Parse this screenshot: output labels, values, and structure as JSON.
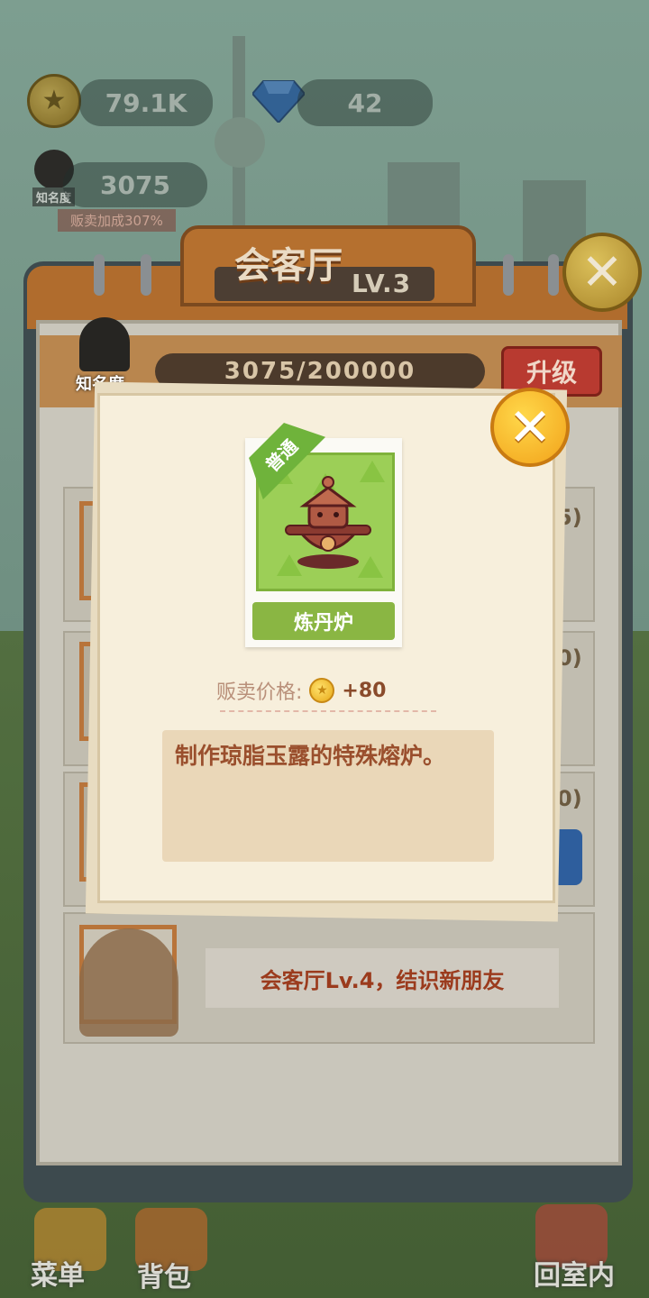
{
  "hud": {
    "coins": "79.1K",
    "gems": "42",
    "fame_value": "3075",
    "fame_label": "知名度",
    "sell_bonus": "贩卖加成307%"
  },
  "hall": {
    "title": "会客厅",
    "level": "LV.3",
    "fame_label": "知名度",
    "fame_progress": "3075/200000",
    "upgrade_label": "升级",
    "side_values": [
      "5)",
      "0)",
      "0)"
    ],
    "locked_text": "会客厅Lv.4，结识新朋友"
  },
  "popup": {
    "rarity": "普通",
    "item_name": "炼丹炉",
    "price_label": "贩卖价格:",
    "price_value": "+80",
    "description": "制作琼脂玉露的特殊熔炉。"
  },
  "nav": {
    "menu": "菜单",
    "bag": "背包",
    "return": "回室内"
  },
  "icons": {
    "close": "close-icon",
    "coin": "coin-icon",
    "gem": "gem-icon"
  },
  "colors": {
    "upgrade_red": "#b83a30",
    "close_gold": "#f2a21a",
    "rarity_green": "#6fb33b"
  }
}
